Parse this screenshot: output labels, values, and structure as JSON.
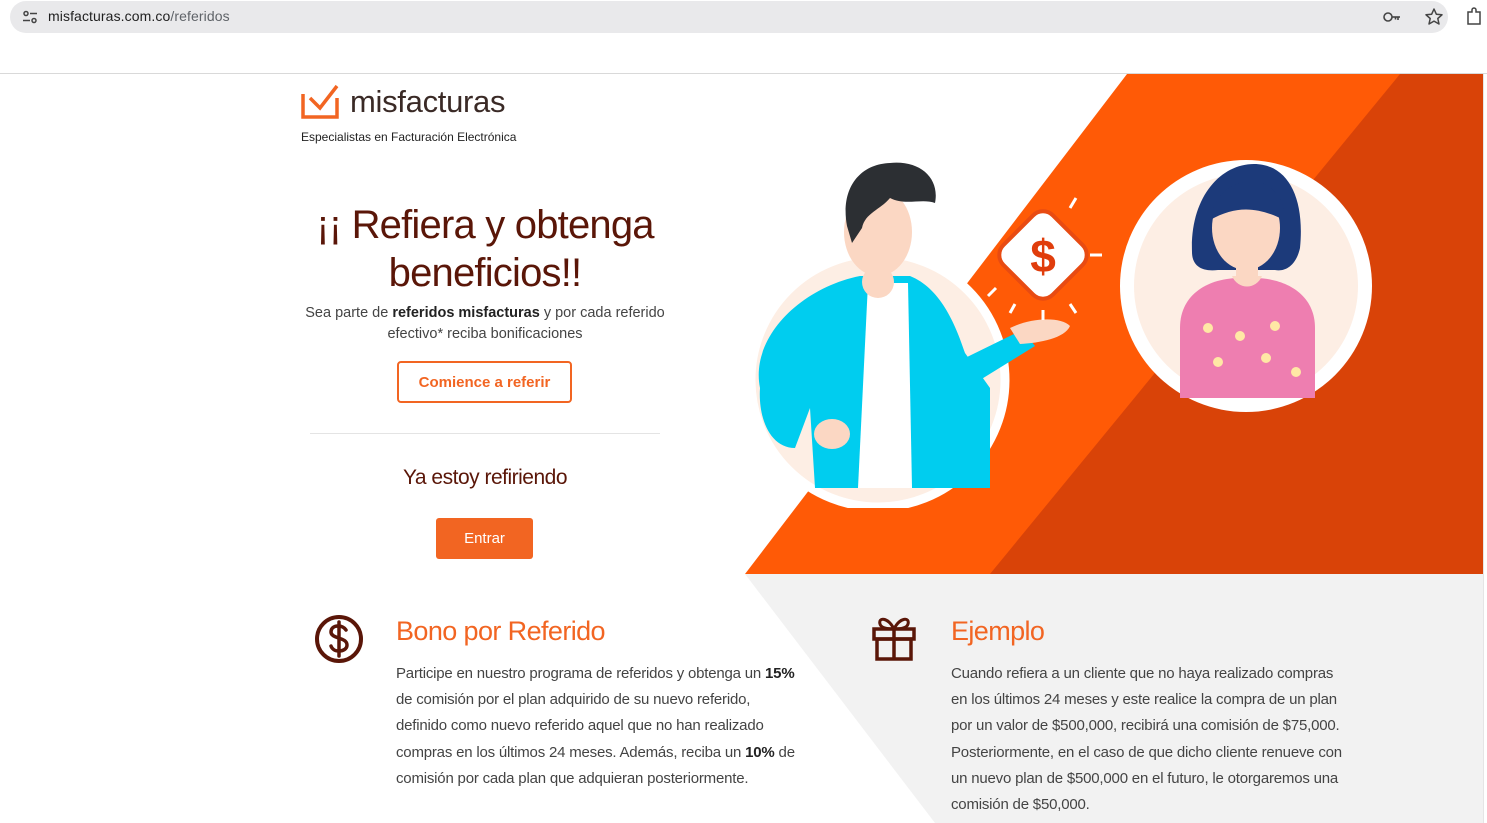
{
  "browser": {
    "url_domain": "misfacturas.com.co",
    "url_path": "/referidos",
    "icons": [
      "tune-icon",
      "key-icon",
      "star-icon",
      "extensions-icon"
    ]
  },
  "brand": {
    "name": "misfacturas",
    "tagline": "Especialistas en Facturación Electrónica",
    "accent": "#f26522",
    "dark_accent": "#5a1608"
  },
  "hero": {
    "title_line1": "¡¡ Refiera y obtenga",
    "title_line2": "beneficios!!",
    "desc_prefix": "Sea parte de ",
    "desc_bold": "referidos misfacturas",
    "desc_suffix": " y por cada referido efectivo* reciba bonificaciones",
    "start_button": "Comience a referir",
    "already_label": "Ya estoy refiriendo",
    "enter_button": "Entrar"
  },
  "features": [
    {
      "icon": "dollar-circle-icon",
      "title": "Bono por Referido",
      "text_1": "Participe en nuestro programa de referidos y obtenga un ",
      "bold_1": "15%",
      "text_2": " de comisión por el plan adquirido de su nuevo referido, definido como nuevo referido aquel que no han realizado compras en los últimos 24 meses. Además, reciba un ",
      "bold_2": "10%",
      "text_3": " de comisión por cada plan que adquieran posteriormente."
    },
    {
      "icon": "gift-icon",
      "title": "Ejemplo",
      "text": "Cuando refiera a un cliente que no haya realizado compras en los últimos 24 meses y este realice la compra de un plan por un valor de $500,000, recibirá una comisión de $75,000. Posteriormente, en el caso de que dicho cliente renueve con un nuevo plan de $500,000 en el futuro, le otorgaremos una comisión de $50,000."
    }
  ],
  "illustration": {
    "dollar_sign": "$"
  }
}
